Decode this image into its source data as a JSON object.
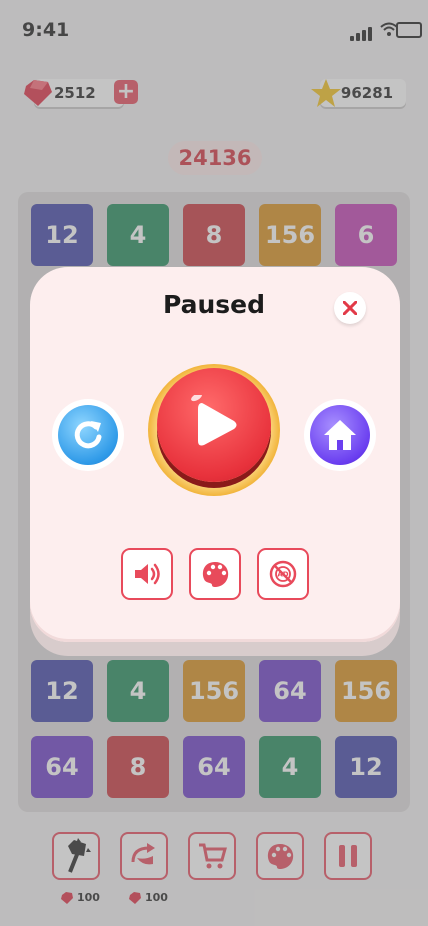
{
  "status": {
    "time": "9:41"
  },
  "currency": {
    "gems": "2512",
    "stars": "96281"
  },
  "score": "24136",
  "board": {
    "rows": [
      [
        {
          "v": "12",
          "c": "#3f42a8"
        },
        {
          "v": "4",
          "c": "#1f8a5a"
        },
        {
          "v": "8",
          "c": "#c8343b"
        },
        {
          "v": "156",
          "c": "#d98f1b"
        },
        {
          "v": "6",
          "c": "#c23cb3"
        }
      ],
      [
        {
          "v": "12",
          "c": "#3f42a8"
        },
        {
          "v": "4",
          "c": "#1f8a5a"
        },
        {
          "v": "156",
          "c": "#d98f1b"
        },
        {
          "v": "64",
          "c": "#6a3bc7"
        },
        {
          "v": "156",
          "c": "#d98f1b"
        }
      ],
      [
        {
          "v": "64",
          "c": "#6a3bc7"
        },
        {
          "v": "8",
          "c": "#c8343b"
        },
        {
          "v": "64",
          "c": "#6a3bc7"
        },
        {
          "v": "4",
          "c": "#1f8a5a"
        },
        {
          "v": "12",
          "c": "#3f42a8"
        }
      ]
    ]
  },
  "tools": {
    "hammer_cost": "100",
    "swap_cost": "100"
  },
  "dialog": {
    "title": "Paused"
  },
  "colors": {
    "accent": "#e84a5b",
    "score_text": "#d3313d"
  }
}
